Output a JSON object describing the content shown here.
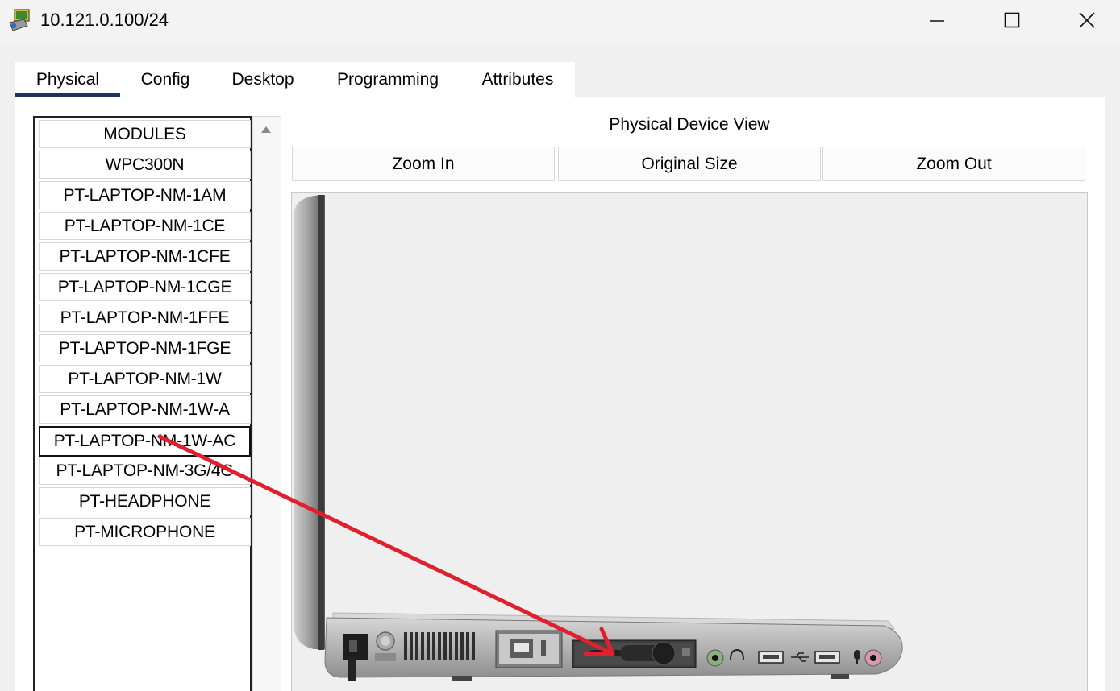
{
  "window": {
    "title": "10.121.0.100/24",
    "app_icon": "packet-tracer-laptop-icon",
    "controls": [
      "minimize-icon",
      "maximize-icon",
      "close-icon"
    ]
  },
  "tabs": [
    {
      "label": "Physical",
      "active": true
    },
    {
      "label": "Config",
      "active": false
    },
    {
      "label": "Desktop",
      "active": false
    },
    {
      "label": "Programming",
      "active": false
    },
    {
      "label": "Attributes",
      "active": false
    }
  ],
  "modules": {
    "header": "MODULES",
    "items": [
      "WPC300N",
      "PT-LAPTOP-NM-1AM",
      "PT-LAPTOP-NM-1CE",
      "PT-LAPTOP-NM-1CFE",
      "PT-LAPTOP-NM-1CGE",
      "PT-LAPTOP-NM-1FFE",
      "PT-LAPTOP-NM-1FGE",
      "PT-LAPTOP-NM-1W",
      "PT-LAPTOP-NM-1W-A",
      "PT-LAPTOP-NM-1W-AC",
      "PT-LAPTOP-NM-3G/4G",
      "PT-HEADPHONE",
      "PT-MICROPHONE"
    ],
    "selected": "PT-LAPTOP-NM-1W-AC"
  },
  "device_view": {
    "title": "Physical Device View",
    "zoom_in": "Zoom In",
    "original_size": "Original Size",
    "zoom_out": "Zoom Out"
  },
  "annotation": {
    "type": "arrow",
    "color": "#e0202e"
  },
  "colors": {
    "tab_underline": "#1c3557",
    "arrow": "#e0202e"
  }
}
